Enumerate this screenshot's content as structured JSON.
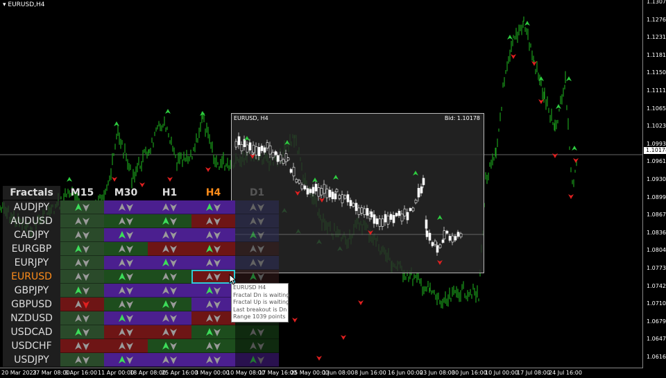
{
  "chart": {
    "title": "EURUSD,H4",
    "current_price": "1.10178",
    "prices": [
      "1.13075",
      "1.12760",
      "1.12310",
      "1.11815",
      "1.11505",
      "1.11110",
      "1.10650",
      "1.10235",
      "1.09930",
      "1.09615",
      "1.09305",
      "1.08990",
      "1.08675",
      "1.08365",
      "1.08045",
      "1.07730",
      "1.07420",
      "1.07105",
      "1.06790",
      "1.06475",
      "1.06160"
    ],
    "times": [
      "20 Mar 2023",
      "27 Mar 08:00",
      "3 Apr 16:00",
      "11 Apr 00:00",
      "18 Apr 08:00",
      "25 Apr 16:00",
      "3 May 00:00",
      "10 May 08:00",
      "17 May 16:00",
      "25 May 00:00",
      "1 Jun 08:00",
      "8 Jun 16:00",
      "16 Jun 00:00",
      "23 Jun 08:00",
      "30 Jun 16:00",
      "10 Jul 00:00",
      "17 Jul 08:00",
      "24 Jul 16:00"
    ]
  },
  "panel": {
    "header": "Fractals",
    "timeframes": [
      "M15",
      "M30",
      "H1",
      "H4",
      "D1"
    ],
    "tf_colors": [
      "#dddddd",
      "#dddddd",
      "#dddddd",
      "#ff8c1a",
      "#555555"
    ],
    "symbols": [
      "AUDJPY",
      "AUDUSD",
      "CADJPY",
      "EURGBP",
      "EURJPY",
      "EURUSD",
      "GBPJPY",
      "GBPUSD",
      "NZDUSD",
      "USDCAD",
      "USDCHF",
      "USDJPY"
    ],
    "symbol_colors": [
      "#dddddd",
      "#dddddd",
      "#dddddd",
      "#dddddd",
      "#dddddd",
      "#ff8c1a",
      "#dddddd",
      "#dddddd",
      "#dddddd",
      "#dddddd",
      "#dddddd",
      "#dddddd"
    ],
    "cell_colors": [
      [
        "#2a4a2a",
        "#4b1f8f",
        "#4b1f8f",
        "#4b1f8f",
        "#2e2e5a"
      ],
      [
        "#2a4a2a",
        "#1d4d1d",
        "#1d4d1d",
        "#6e1515",
        "#2e2e5a"
      ],
      [
        "#2a4a2a",
        "#4b1f8f",
        "#4b1f8f",
        "#4b1f8f",
        "#2e2e5a"
      ],
      [
        "#2a4a2a",
        "#1d4d1d",
        "#6e1515",
        "#6e1515",
        "#3a1e1e"
      ],
      [
        "#2a4a2a",
        "#4b1f8f",
        "#4b1f8f",
        "#4b1f8f",
        "#2e2e5a"
      ],
      [
        "#2a4a2a",
        "#1d4d1d",
        "#1d4d1d",
        "#6e1515",
        "#3a1e1e"
      ],
      [
        "#2a4a2a",
        "#4b1f8f",
        "#4b1f8f",
        "#4b1f8f",
        "#2e2e5a"
      ],
      [
        "#6e1515",
        "#1d4d1d",
        "#1d4d1d",
        "#4b1f8f",
        "#2e2e5a"
      ],
      [
        "#2a4a2a",
        "#4b1f8f",
        "#4b1f8f",
        "#6e1515",
        "#1d3a1d"
      ],
      [
        "#2a4a2a",
        "#6e1515",
        "#6e1515",
        "#1d4d1d",
        "#1d4d1d"
      ],
      [
        "#6e1515",
        "#6e1515",
        "#1d4d1d",
        "#1d4d1d",
        "#1d4d1d"
      ],
      [
        "#2a4a2a",
        "#4b1f8f",
        "#4b1f8f",
        "#4b1f8f",
        "#4b1f8f"
      ]
    ]
  },
  "mini": {
    "title": "EURUSD, H4",
    "bid": "Bid: 1.10178"
  },
  "tooltip": {
    "lines": [
      "EURUSD H4",
      "Fractal Dn is waiting",
      "Fractal Up is waiting",
      "Last breakout is Dn",
      "Range 1039 points"
    ]
  },
  "colors": {
    "candle": "#1a9e1a",
    "up_fractal": "#2ecc40",
    "down_fractal": "#e02020"
  }
}
